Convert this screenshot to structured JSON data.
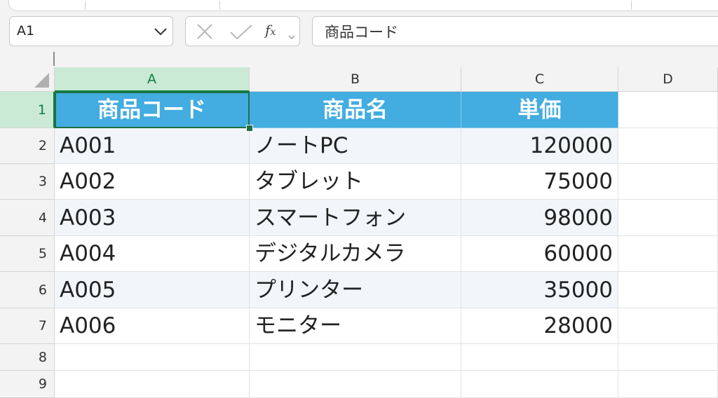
{
  "name_box": {
    "value": "A1"
  },
  "formula_bar": {
    "fx_symbol": "fx",
    "value": "商品コード"
  },
  "columns": [
    "A",
    "B",
    "C",
    "D"
  ],
  "rows": [
    "1",
    "2",
    "3",
    "4",
    "5",
    "6",
    "7",
    "8",
    "9"
  ],
  "table": {
    "headers": [
      "商品コード",
      "商品名",
      "単価"
    ],
    "records": [
      [
        "A001",
        "ノートPC",
        "120000"
      ],
      [
        "A002",
        "タブレット",
        "75000"
      ],
      [
        "A003",
        "スマートフォン",
        "98000"
      ],
      [
        "A004",
        "デジタルカメラ",
        "60000"
      ],
      [
        "A005",
        "プリンター",
        "35000"
      ],
      [
        "A006",
        "モニター",
        "28000"
      ]
    ]
  },
  "colors": {
    "header_fill": "#43ace0",
    "selection": "#1e7145",
    "selected_heading": "#caead5",
    "banded_row": "#f2f5fa"
  },
  "icons": [
    "chevron-down-icon",
    "cancel-x-icon",
    "enter-check-icon",
    "function-icon"
  ]
}
